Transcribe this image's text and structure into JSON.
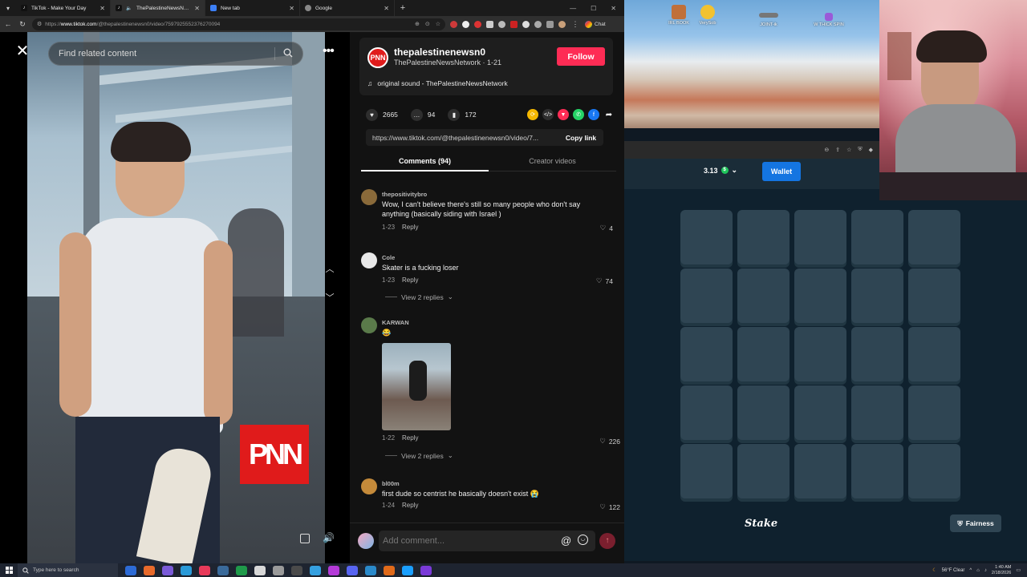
{
  "browser": {
    "tabs": [
      {
        "label": "TikTok - Make Your Day",
        "fav_color": "#000000"
      },
      {
        "label": "ThePalestineNewsNetwork (@",
        "fav_color": "#000000"
      },
      {
        "label": "New tab",
        "fav_color": "#3c7ff5"
      },
      {
        "label": "Google",
        "fav_color": "#8a8a8a"
      }
    ],
    "url_prefix": "https://",
    "url_host": "www.tiktok.com",
    "url_path": "/@thepalestinenewsn0/video/7597925552376270094",
    "chat_label": "Chat"
  },
  "tiktok": {
    "search_placeholder": "Find related content",
    "author": {
      "handle": "thepalestinenewsn0",
      "nickname": "ThePalestineNewsNetwork · 1-21",
      "avatar_text": "PNN",
      "follow_label": "Follow",
      "sound": "original sound - ThePalestineNewsNetwork"
    },
    "stats": {
      "likes": "2665",
      "comments": "94",
      "saves": "172"
    },
    "link": "https://www.tiktok.com/@thepalestinenewsn0/video/7...",
    "copy_label": "Copy link",
    "tabs": {
      "comments": "Comments (94)",
      "creator": "Creator videos"
    },
    "watermark": "PNN",
    "comments": [
      {
        "user": "thepositivitybro",
        "text": "Wow, I can't believe there's still so many people who don't say anything (basically siding with Israel )",
        "date": "1-23",
        "reply": "Reply",
        "likes": "4",
        "avatar_color": "#8a6a3a"
      },
      {
        "user": "Cole",
        "text": "Skater is a fucking loser",
        "date": "1-23",
        "reply": "Reply",
        "likes": "74",
        "avatar_color": "#e8e8e8",
        "replies": "View 2 replies"
      },
      {
        "user": "KARWAN",
        "text": "😂",
        "date": "1-22",
        "reply": "Reply",
        "likes": "226",
        "avatar_color": "#5a7a4a",
        "replies": "View 2 replies"
      },
      {
        "user": "bl00m",
        "text": "first dude so centrist he basically doesn't exist 😭",
        "date": "1-24",
        "reply": "Reply",
        "likes": "122",
        "avatar_color": "#c48a3a"
      }
    ],
    "comment_placeholder": "Add comment..."
  },
  "desktop": {
    "icons": [
      {
        "label": "IRL BOOK",
        "color": "#c0703a"
      },
      {
        "label": "VerySob",
        "color": "#f2c230"
      },
      {
        "label": "JOINT-ik",
        "color": "#777777"
      },
      {
        "label": "W THICK SPIN",
        "color": "#9a5ad8"
      }
    ]
  },
  "stake": {
    "balance": "3.13",
    "wallet_label": "Wallet",
    "logo": "Stake",
    "fairness_label": "Fairness",
    "grid_rows": 5,
    "grid_cols": 5
  },
  "taskbar": {
    "search_placeholder": "Type here to search",
    "weather": "56°F Clear",
    "time": "1:40 AM",
    "date": "2/18/2026",
    "app_colors": [
      "#2d6bd6",
      "#e86a2b",
      "#7a5ad8",
      "#2a9ad8",
      "#e83a5a",
      "#3a6a9a",
      "#1f9a4a",
      "#d8d8d8",
      "#9a9a9a",
      "#4a4a4a",
      "#35a0e0",
      "#b43ad8",
      "#5865f2",
      "#2a8acb",
      "#e06a1a",
      "#1a9fff",
      "#7a3ad8"
    ]
  }
}
